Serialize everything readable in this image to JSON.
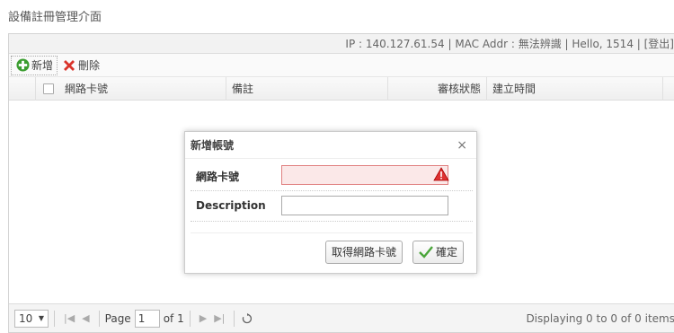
{
  "page": {
    "title": "設備註冊管理介面"
  },
  "info_bar": {
    "text": "IP : 140.127.61.54 | MAC Addr : 無法辨識 | Hello, 1514 | [登出]"
  },
  "toolbar": {
    "add_label": "新增",
    "delete_label": "刪除"
  },
  "grid": {
    "columns": [
      "網路卡號",
      "備註",
      "審核狀態",
      "建立時間"
    ]
  },
  "pager": {
    "page_size": "10",
    "page_label": "Page",
    "page_value": "1",
    "of_label": "of 1",
    "status": "Displaying 0 to 0 of 0 items"
  },
  "dialog": {
    "title": "新增帳號",
    "close": "×",
    "fields": [
      {
        "label": "網路卡號",
        "value": ""
      },
      {
        "label": "Description",
        "value": ""
      }
    ],
    "get_mac_button": "取得網路卡號",
    "confirm_button": "確定"
  },
  "colors": {
    "error_bg": "#fbe8e8",
    "error_border": "#e08080",
    "add_green": "#3a9d2f",
    "delete_red": "#d9342b"
  }
}
